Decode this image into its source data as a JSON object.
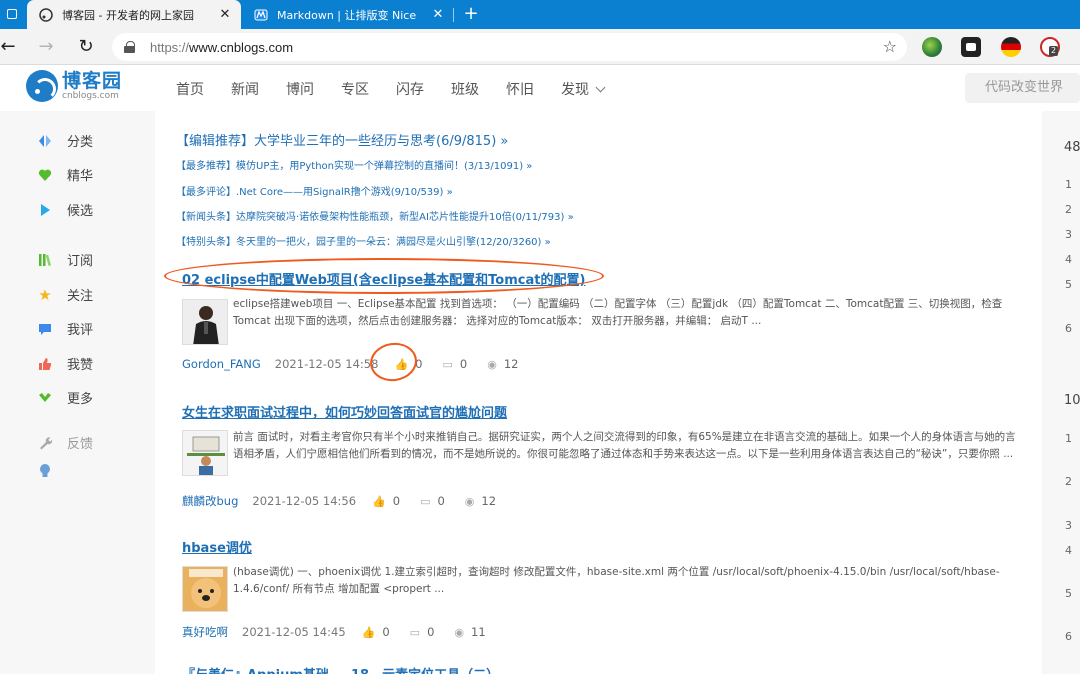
{
  "browser": {
    "tabs": [
      {
        "title": "博客园 - 开发者的网上家园",
        "active": true
      },
      {
        "title": "Markdown | 让排版变 Nice",
        "active": false
      }
    ],
    "url_prefix": "https://",
    "url_host": "www.cnblogs.com",
    "extension_badge": "2"
  },
  "site": {
    "logo_cn": "博客园",
    "logo_en": "cnblogs.com",
    "nav": [
      "首页",
      "新闻",
      "博问",
      "专区",
      "闪存",
      "班级",
      "怀旧",
      "发现"
    ],
    "search_text": "代码改变世界"
  },
  "sidebar": {
    "items": [
      {
        "label": "分类",
        "icon": "category-icon",
        "color": "#3d8be8"
      },
      {
        "label": "精华",
        "icon": "heart-icon",
        "color": "#55bb2e"
      },
      {
        "label": "候选",
        "icon": "play-icon",
        "color": "#29a8e8"
      },
      {
        "label": "订阅",
        "icon": "books-icon",
        "color": "#55bb2e"
      },
      {
        "label": "关注",
        "icon": "star-icon",
        "color": "#f5b51b"
      },
      {
        "label": "我评",
        "icon": "comment-icon",
        "color": "#3d8be8"
      },
      {
        "label": "我赞",
        "icon": "thumbs-up-icon",
        "color": "#f16655"
      },
      {
        "label": "更多",
        "icon": "chevron-icon",
        "color": "#55bb2e"
      },
      {
        "label": "反馈",
        "icon": "wrench-icon",
        "color": "#aaaaaa"
      }
    ]
  },
  "promos": [
    {
      "tag": "【编辑推荐】",
      "text": "大学毕业三年的一些经历与思考(6/9/815) »"
    },
    {
      "tag": "【最多推荐】",
      "text": "模仿UP主，用Python实现一个弹幕控制的直播间！(3/13/1091) »"
    },
    {
      "tag": "【最多评论】",
      "text": ".Net Core——用SignalR撸个游戏(9/10/539) »"
    },
    {
      "tag": "【新闻头条】",
      "text": "达摩院突破冯·诺依曼架构性能瓶颈，新型AI芯片性能提升10倍(0/11/793) »"
    },
    {
      "tag": "【特别头条】",
      "text": "冬天里的一把火，园子里的一朵云：满园尽是火山引擎(12/20/3260) »"
    }
  ],
  "posts": [
    {
      "title": "02 eclipse中配置Web项目(含eclipse基本配置和Tomcat的配置)",
      "summary": "eclipse搭建web项目 一、Eclipse基本配置 找到首选项： （一）配置编码 （二）配置字体 （三）配置jdk （四）配置Tomcat 二、Tomcat配置 三、切换视图，检查Tomcat 出现下面的选项，然后点击创建服务器： 选择对应的Tomcat版本： 双击打开服务器，并编辑： 启动T ...",
      "author": "Gordon_FANG",
      "date": "2021-12-05 14:58",
      "likes": "0",
      "comments": "0",
      "views": "12"
    },
    {
      "title": "女生在求职面试过程中，如何巧妙回答面试官的尴尬问题",
      "summary": "前言 面试时，对看主考官你只有半个小时来推销自己。据研究证实，两个人之间交流得到的印象，有65%是建立在非语言交流的基础上。如果一个人的身体语言与她的言语相矛盾，人们宁愿相信他们所看到的情况，而不是她所说的。你很可能忽略了通过体态和手势来表达这一点。以下是一些利用身体语言表达自己的“秘诀”，只要你照 ...",
      "author": "麒麟改bug",
      "date": "2021-12-05 14:56",
      "likes": "0",
      "comments": "0",
      "views": "12"
    },
    {
      "title": "hbase调优",
      "summary": "(hbase调优) 一、phoenix调优 1.建立索引超时，查询超时 修改配置文件，hbase-site.xml 两个位置 /usr/local/soft/phoenix-4.15.0/bin /usr/local/soft/hbase-1.4.6/conf/ 所有节点 增加配置 <propert ...",
      "author": "真好吃啊",
      "date": "2021-12-05 14:45",
      "likes": "0",
      "comments": "0",
      "views": "11"
    }
  ],
  "next_post_title_partial": "『与善仁』Appium基础 — 18、元素定位工具（二）",
  "right_numbers": [
    "48",
    "1",
    "2",
    "3",
    "4",
    "5",
    "6",
    "10",
    "1",
    "2",
    "3",
    "4",
    "5",
    "6"
  ]
}
